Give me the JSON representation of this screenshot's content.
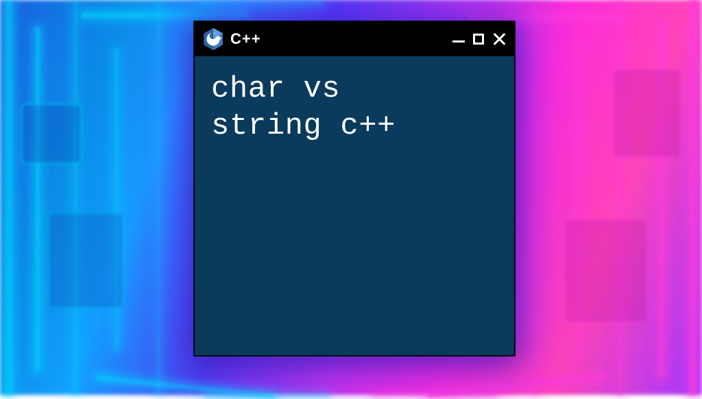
{
  "window": {
    "title": "C++",
    "icon_name": "cpp-logo-icon",
    "controls": {
      "minimize": "minimize",
      "maximize": "maximize",
      "close": "close"
    },
    "body_text": "char vs\nstring c++"
  },
  "colors": {
    "titlebar_bg": "#000000",
    "body_bg": "#0a3a5c",
    "text": "#ffffff",
    "glow1": "#00dcff",
    "glow2": "#ff2ed8"
  }
}
